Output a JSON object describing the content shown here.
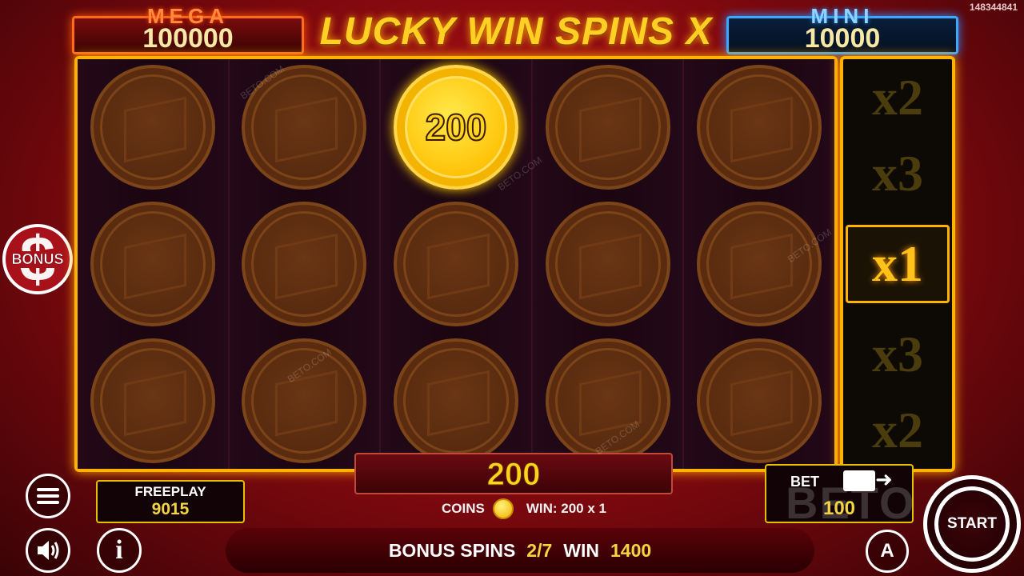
{
  "round_id": "148344841",
  "title": "LUCKY WIN SPINS X",
  "jackpots": {
    "mega": {
      "label": "MEGA",
      "value": "100000"
    },
    "mini": {
      "label": "MINI",
      "value": "10000"
    }
  },
  "reels": [
    [
      {
        "type": "blank"
      },
      {
        "type": "blank"
      },
      {
        "type": "blank"
      }
    ],
    [
      {
        "type": "blank"
      },
      {
        "type": "blank"
      },
      {
        "type": "blank"
      }
    ],
    [
      {
        "type": "gold",
        "value": "200"
      },
      {
        "type": "blank"
      },
      {
        "type": "blank"
      }
    ],
    [
      {
        "type": "blank"
      },
      {
        "type": "blank"
      },
      {
        "type": "blank"
      }
    ],
    [
      {
        "type": "blank"
      },
      {
        "type": "blank"
      },
      {
        "type": "blank"
      }
    ]
  ],
  "multipliers": [
    "x2",
    "x3",
    "x1",
    "x3",
    "x2"
  ],
  "active_multiplier_index": 2,
  "bonus_button": {
    "label": "BONUS",
    "symbol": "$"
  },
  "win_display": {
    "value": "200",
    "coins_label": "COINS",
    "win_text": "WIN: 200 x 1"
  },
  "freeplay": {
    "label": "FREEPLAY",
    "value": "9015"
  },
  "bet": {
    "label": "BET",
    "value": "100",
    "arrow": "➜"
  },
  "bonus_spins": {
    "label": "BONUS SPINS",
    "count": "2/7",
    "win_label": "WIN",
    "win_value": "1400"
  },
  "start_button": {
    "label": "START"
  },
  "auto_button": {
    "label": "A"
  },
  "info_button": {
    "label": "i"
  },
  "watermark": {
    "text": "BETO.COM",
    "logo": "BETO"
  },
  "colors": {
    "accent": "#ffb300",
    "background": "#8b0a10",
    "value_yellow": "#f2d540"
  }
}
